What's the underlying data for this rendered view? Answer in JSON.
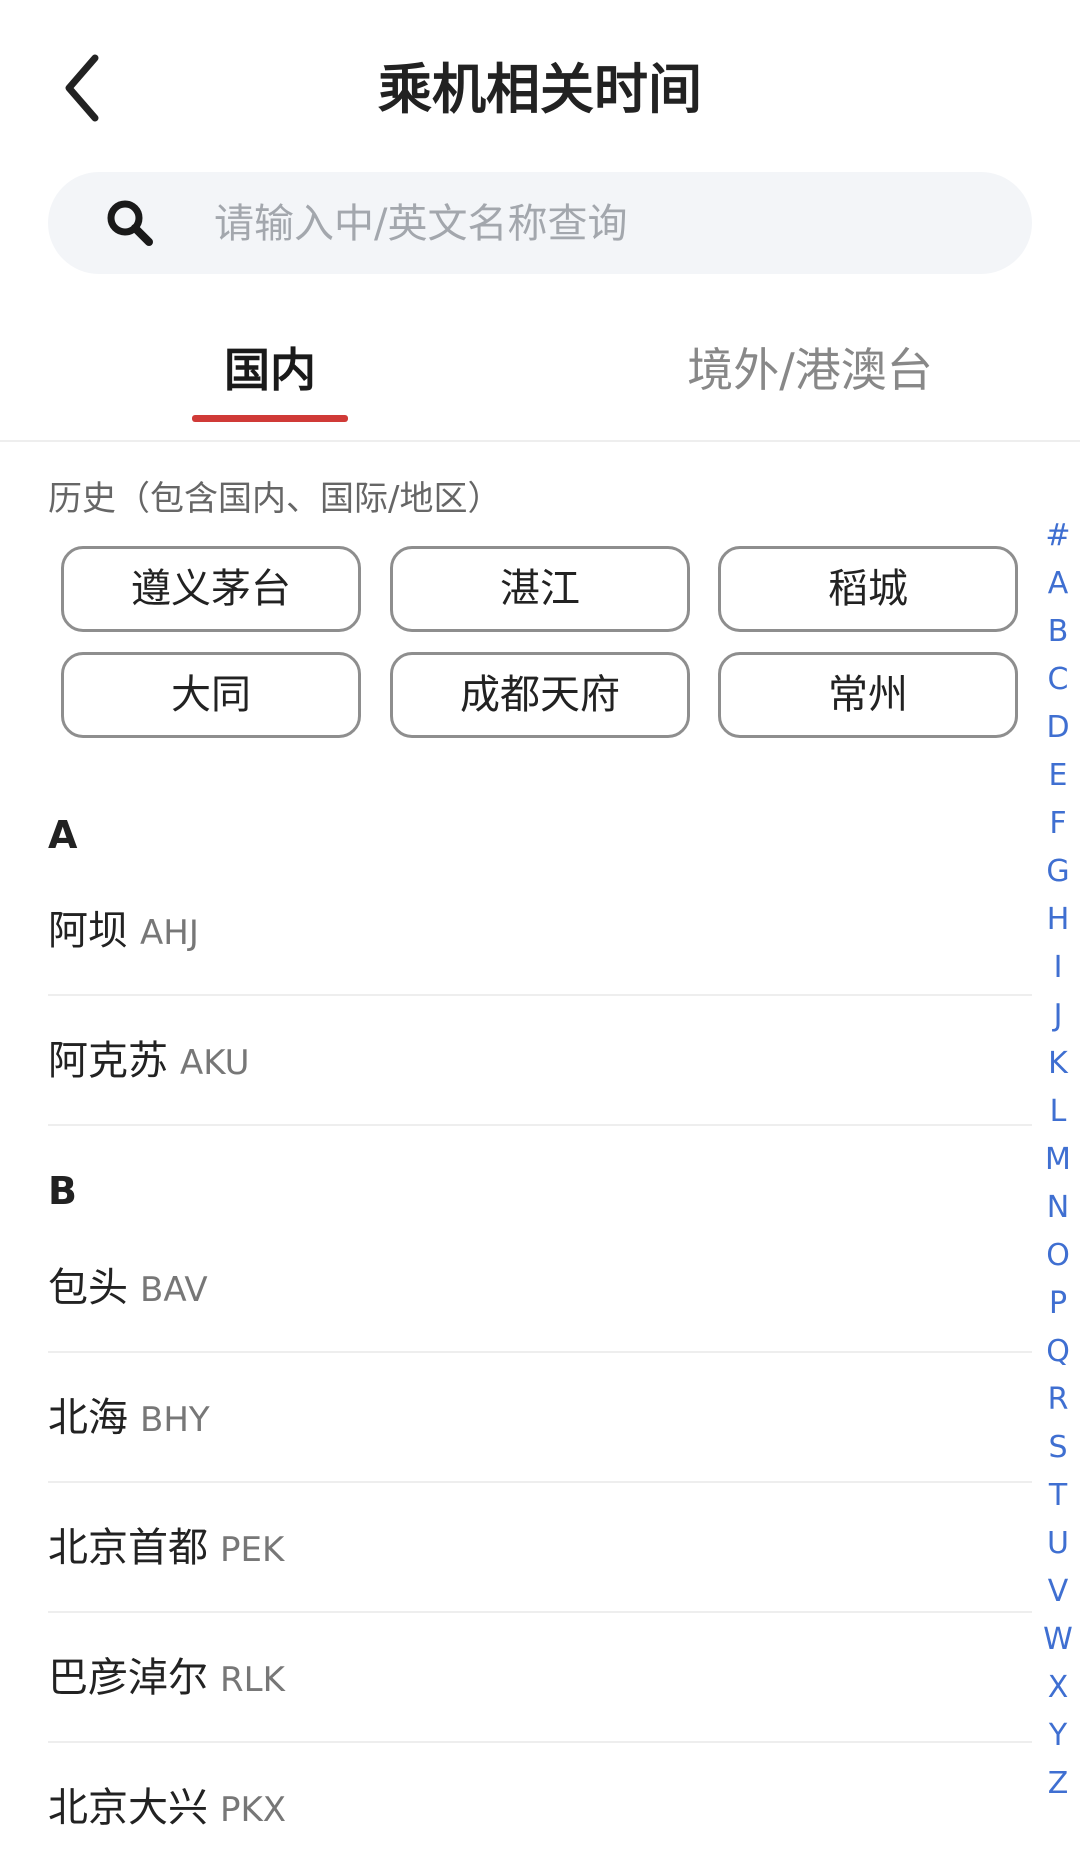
{
  "header": {
    "title": "乘机相关时间",
    "back_icon": "chevron-left-icon"
  },
  "search": {
    "placeholder": "请输入中/英文名称查询",
    "icon": "search-icon",
    "value": ""
  },
  "tabs": [
    {
      "label": "国内",
      "active": true
    },
    {
      "label": "境外/港澳台",
      "active": false
    }
  ],
  "accent_color": "#d03a37",
  "index_color": "#3f6fd1",
  "history": {
    "label": "历史（包含国内、国际/地区）",
    "items": [
      "遵义茅台",
      "湛江",
      "稻城",
      "大同",
      "成都天府",
      "常州"
    ]
  },
  "sections": [
    {
      "letter": "A",
      "airports": [
        {
          "name": "阿坝",
          "code": "AHJ"
        },
        {
          "name": "阿克苏",
          "code": "AKU"
        }
      ]
    },
    {
      "letter": "B",
      "airports": [
        {
          "name": "包头",
          "code": "BAV"
        },
        {
          "name": "北海",
          "code": "BHY"
        },
        {
          "name": "北京首都",
          "code": "PEK"
        },
        {
          "name": "巴彦淖尔",
          "code": "RLK"
        },
        {
          "name": "北京大兴",
          "code": "PKX"
        }
      ]
    }
  ],
  "index_letters": [
    "#",
    "A",
    "B",
    "C",
    "D",
    "E",
    "F",
    "G",
    "H",
    "I",
    "J",
    "K",
    "L",
    "M",
    "N",
    "O",
    "P",
    "Q",
    "R",
    "S",
    "T",
    "U",
    "V",
    "W",
    "X",
    "Y",
    "Z"
  ]
}
